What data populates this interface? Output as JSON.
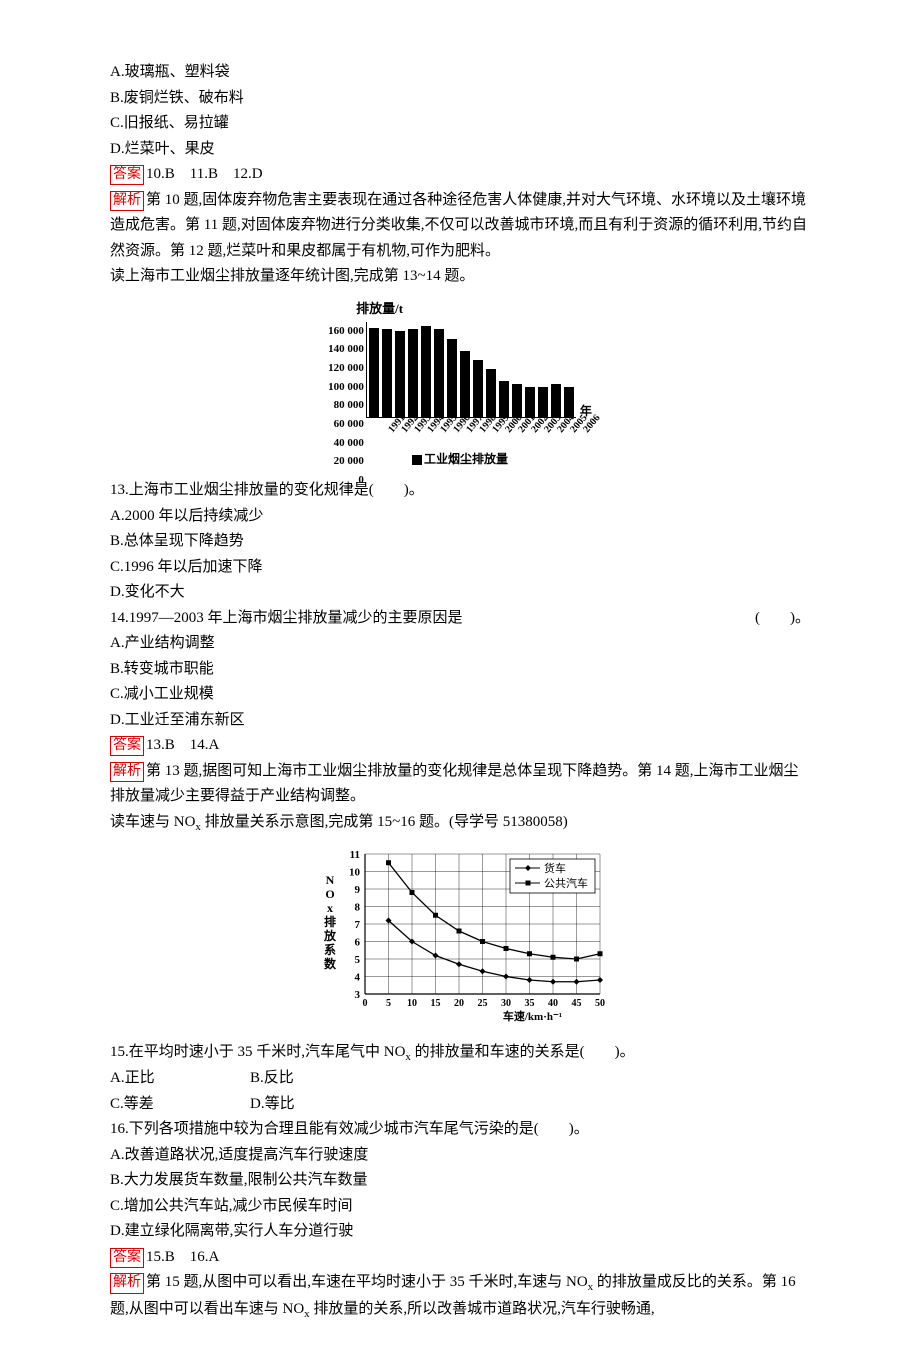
{
  "q10options": {
    "a": "A.玻璃瓶、塑料袋",
    "b": "B.废铜烂铁、破布料",
    "c": "C.旧报纸、易拉罐",
    "d": "D.烂菜叶、果皮"
  },
  "labels": {
    "answer": "答案",
    "explain": "解析"
  },
  "ans10_12": "10.B　11.B　12.D",
  "exp10_12": "第 10 题,固体废弃物危害主要表现在通过各种途径危害人体健康,并对大气环境、水环境以及土壤环境造成危害。第 11 题,对固体废弃物进行分类收集,不仅可以改善城市环境,而且有利于资源的循环利用,节约自然资源。第 12 题,烂菜叶和果皮都属于有机物,可作为肥料。",
  "lead13": "读上海市工业烟尘排放量逐年统计图,完成第 13~14 题。",
  "chart_data": [
    {
      "type": "bar",
      "title": "",
      "ylabel": "排放量/t",
      "xlabel": "年",
      "legend": "工业烟尘排放量",
      "ylim": [
        0,
        160000
      ],
      "yticks": [
        0,
        20000,
        40000,
        60000,
        80000,
        100000,
        120000,
        140000,
        160000
      ],
      "categories": [
        "1991",
        "1992",
        "1993",
        "1994",
        "1995",
        "1996",
        "1997",
        "1998",
        "1999",
        "2000",
        "2001",
        "2002",
        "2003",
        "2004",
        "2005",
        "2006"
      ],
      "values": [
        150000,
        148000,
        145000,
        148000,
        152000,
        148000,
        130000,
        110000,
        95000,
        80000,
        60000,
        55000,
        50000,
        50000,
        55000,
        50000
      ]
    },
    {
      "type": "line",
      "title": "",
      "ylabel": "NOx排放系数",
      "xlabel": "车速/km·h⁻¹",
      "xlim": [
        0,
        50
      ],
      "ylim": [
        3,
        11
      ],
      "xticks": [
        0,
        5,
        10,
        15,
        20,
        25,
        30,
        35,
        40,
        45,
        50
      ],
      "yticks": [
        3,
        4,
        5,
        6,
        7,
        8,
        9,
        10,
        11
      ],
      "legend_pos": "top-right",
      "series": [
        {
          "name": "货车",
          "marker": "diamond",
          "x": [
            5,
            10,
            15,
            20,
            25,
            30,
            35,
            40,
            45,
            50
          ],
          "y": [
            7.2,
            6.0,
            5.2,
            4.7,
            4.3,
            4.0,
            3.8,
            3.7,
            3.7,
            3.8
          ]
        },
        {
          "name": "公共汽车",
          "marker": "square",
          "x": [
            5,
            10,
            15,
            20,
            25,
            30,
            35,
            40,
            45,
            50
          ],
          "y": [
            10.5,
            8.8,
            7.5,
            6.6,
            6.0,
            5.6,
            5.3,
            5.1,
            5.0,
            5.3
          ]
        }
      ]
    }
  ],
  "q13": {
    "stem": "13.上海市工业烟尘排放量的变化规律是(　　)。",
    "a": "A.2000 年以后持续减少",
    "b": "B.总体呈现下降趋势",
    "c": "C.1996 年以后加速下降",
    "d": "D.变化不大"
  },
  "q14": {
    "stem_left": "14.1997—2003 年上海市烟尘排放量减少的主要原因是",
    "stem_right": "(　　)。",
    "a": "A.产业结构调整",
    "b": "B.转变城市职能",
    "c": "C.减小工业规模",
    "d": "D.工业迁至浦东新区"
  },
  "ans13_14": "13.B　14.A",
  "exp13_14": "第 13 题,据图可知上海市工业烟尘排放量的变化规律是总体呈现下降趋势。第 14 题,上海市工业烟尘排放量减少主要得益于产业结构调整。",
  "lead15_a": "读车速与 NO",
  "lead15_b": " 排放量关系示意图,完成第 15~16 题。(导学号 51380058)",
  "nox_sub": "x",
  "q15": {
    "stem_a": "15.在平均时速小于 35 千米时,汽车尾气中 NO",
    "stem_b": " 的排放量和车速的关系是(　　)。",
    "a": "A.正比",
    "b": "B.反比",
    "c": "C.等差",
    "d": "D.等比"
  },
  "q16": {
    "stem": "16.下列各项措施中较为合理且能有效减少城市汽车尾气污染的是(　　)。",
    "a": "A.改善道路状况,适度提高汽车行驶速度",
    "b": "B.大力发展货车数量,限制公共汽车数量",
    "c": "C.增加公共汽车站,减少市民候车时间",
    "d": "D.建立绿化隔离带,实行人车分道行驶"
  },
  "ans15_16": "15.B　16.A",
  "exp15_16_a": "第 15 题,从图中可以看出,车速在平均时速小于 35 千米时,车速与 NO",
  "exp15_16_b": " 的排放量成反比的关系。第 16 题,从图中可以看出车速与 NO",
  "exp15_16_c": " 排放量的关系,所以改善城市道路状况,汽车行驶畅通,"
}
